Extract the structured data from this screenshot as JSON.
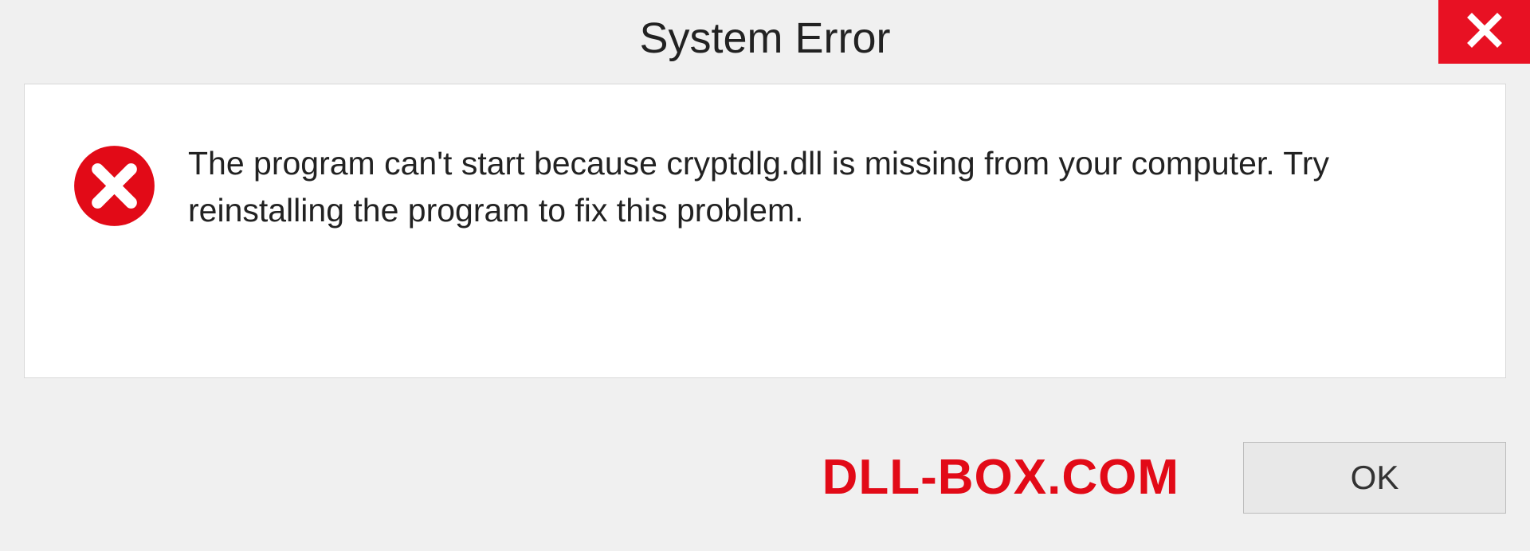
{
  "dialog": {
    "title": "System Error",
    "message": "The program can't start because cryptdlg.dll is missing from your computer. Try reinstalling the program to fix this problem.",
    "ok_label": "OK"
  },
  "watermark": "DLL-BOX.COM"
}
